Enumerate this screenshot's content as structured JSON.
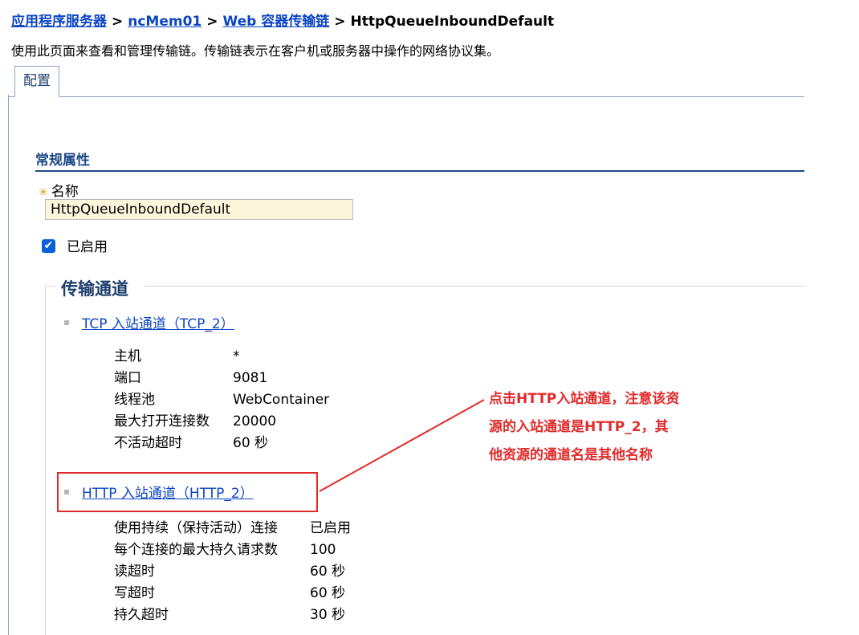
{
  "breadcrumb": {
    "items": [
      "应用程序服务器",
      "ncMem01",
      "Web 容器传输链"
    ],
    "separator": ">",
    "current": "HttpQueueInboundDefault"
  },
  "description": "使用此页面来查看和管理传输链。传输链表示在客户机或服务器中操作的网络协议集。",
  "tabs": [
    {
      "label": "配置"
    }
  ],
  "general": {
    "title": "常规属性",
    "name_label": "名称",
    "name_value": "HttpQueueInboundDefault",
    "enabled_label": "已启用"
  },
  "transport": {
    "legend": "传输通道",
    "channels": [
      {
        "link": "TCP 入站通道（TCP_2）",
        "props": [
          {
            "k": "主机",
            "v": "*"
          },
          {
            "k": "端口",
            "v": "9081"
          },
          {
            "k": "线程池",
            "v": "WebContainer"
          },
          {
            "k": "最大打开连接数",
            "v": "20000"
          },
          {
            "k": "不活动超时",
            "v": "60 秒"
          }
        ]
      },
      {
        "link": "HTTP 入站通道（HTTP_2）",
        "props": [
          {
            "k": "使用持续（保持活动）连接",
            "v": "已启用"
          },
          {
            "k": "每个连接的最大持久请求数",
            "v": "100"
          },
          {
            "k": "读超时",
            "v": "60 秒"
          },
          {
            "k": "写超时",
            "v": "60 秒"
          },
          {
            "k": "持久超时",
            "v": "30 秒"
          }
        ]
      }
    ]
  },
  "annotation": {
    "lines": [
      "点击HTTP入站通道，注意该资",
      "源的入站通道是HTTP_2，其",
      "他资源的通道名是其他名称"
    ],
    "color": "#e12a2a"
  }
}
